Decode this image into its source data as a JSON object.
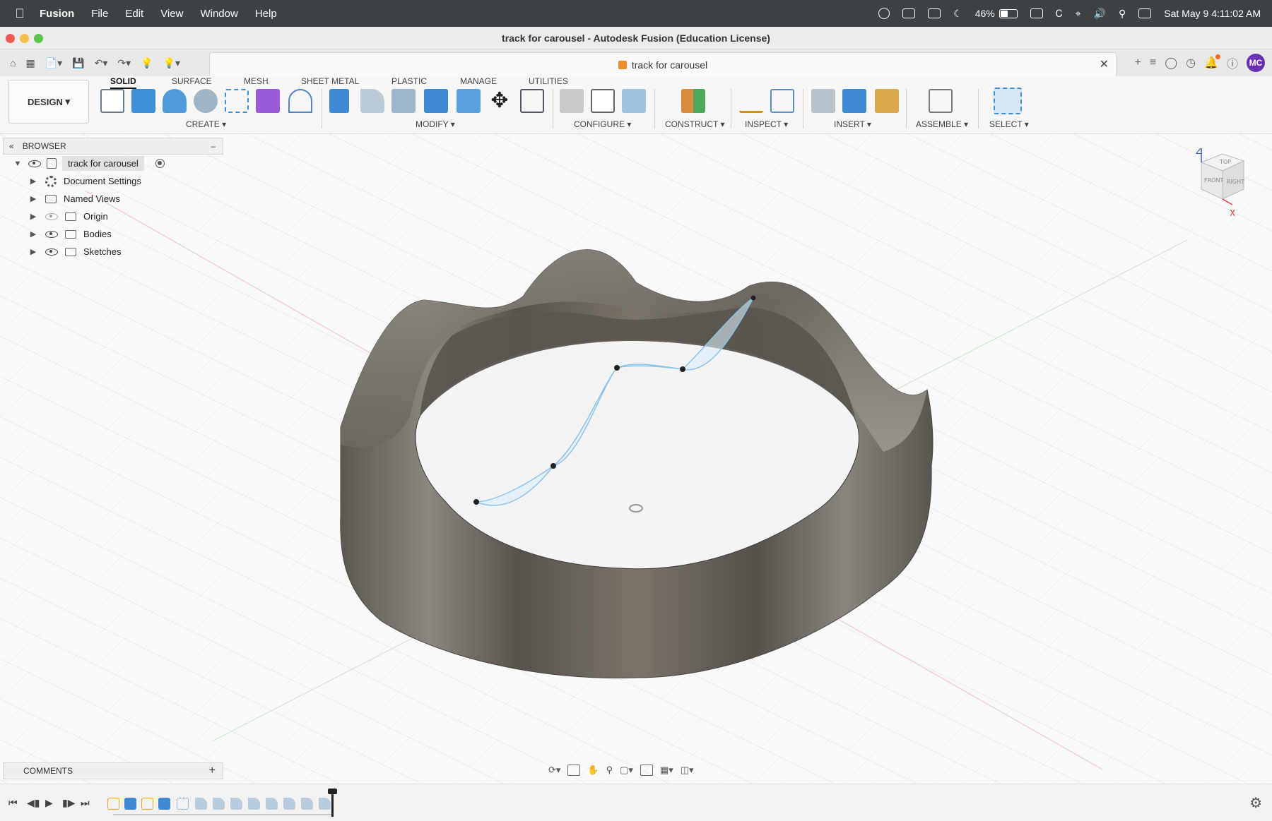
{
  "menubar": {
    "app_name": "Fusion",
    "items": [
      "File",
      "Edit",
      "View",
      "Window",
      "Help"
    ],
    "battery_percent": "46%",
    "battery_level": 0.46,
    "datetime": "Sat May 9  4:11:02 AM"
  },
  "window": {
    "title": "track for carousel - Autodesk Fusion (Education License)"
  },
  "document_tab": {
    "label": "track for carousel"
  },
  "user": {
    "initials": "MC"
  },
  "toolbar": {
    "workspace_button": "DESIGN",
    "tabs": [
      "SOLID",
      "SURFACE",
      "MESH",
      "SHEET METAL",
      "PLASTIC",
      "MANAGE",
      "UTILITIES"
    ],
    "active_tab": "SOLID",
    "groups": [
      "CREATE",
      "MODIFY",
      "CONFIGURE",
      "CONSTRUCT",
      "INSPECT",
      "INSERT",
      "ASSEMBLE",
      "SELECT"
    ]
  },
  "browser": {
    "title": "BROWSER",
    "root": "track for carousel",
    "items": [
      {
        "label": "Document Settings",
        "icon": "gear-icon"
      },
      {
        "label": "Named Views",
        "icon": "folder-icon"
      },
      {
        "label": "Origin",
        "icon": "folder-icon",
        "hidden": true
      },
      {
        "label": "Bodies",
        "icon": "folder-icon"
      },
      {
        "label": "Sketches",
        "icon": "folder-icon"
      }
    ]
  },
  "viewcube": {
    "top": "TOP",
    "front": "FRONT",
    "right": "RIGHT",
    "axis_z": "Z",
    "axis_x": "X"
  },
  "comments": {
    "title": "COMMENTS"
  },
  "colors": {
    "accent_blue": "#2f8fd8",
    "body_metal": "#6b655c",
    "create_green": "#2aa84a",
    "avatar_purple": "#6a2fb5"
  }
}
